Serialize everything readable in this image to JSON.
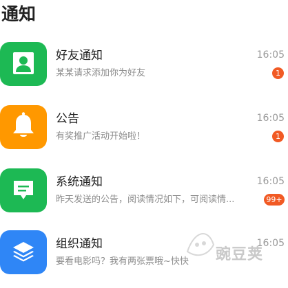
{
  "header": {
    "title": "通知"
  },
  "colors": {
    "green": "#1db954",
    "orange": "#ff9800",
    "blue": "#2f86f6",
    "badge": "#f15a24"
  },
  "items": [
    {
      "icon": "user-icon",
      "name": "好友通知",
      "message": "某某请求添加你为好友",
      "time": "16:05",
      "badge": "1"
    },
    {
      "icon": "bell-icon",
      "name": "公告",
      "message": "有奖推广活动开始啦！",
      "time": "16:05",
      "badge": "1"
    },
    {
      "icon": "message-icon",
      "name": "系统通知",
      "message": "昨天发送的公告，阅读情况如下，可阅读情...",
      "time": "16:05",
      "badge": "99+"
    },
    {
      "icon": "layers-icon",
      "name": "组织通知",
      "message": "要看电影吗？我有两张票哦~快快",
      "time": "16:05"
    }
  ],
  "watermark": {
    "text": "豌豆荚"
  }
}
